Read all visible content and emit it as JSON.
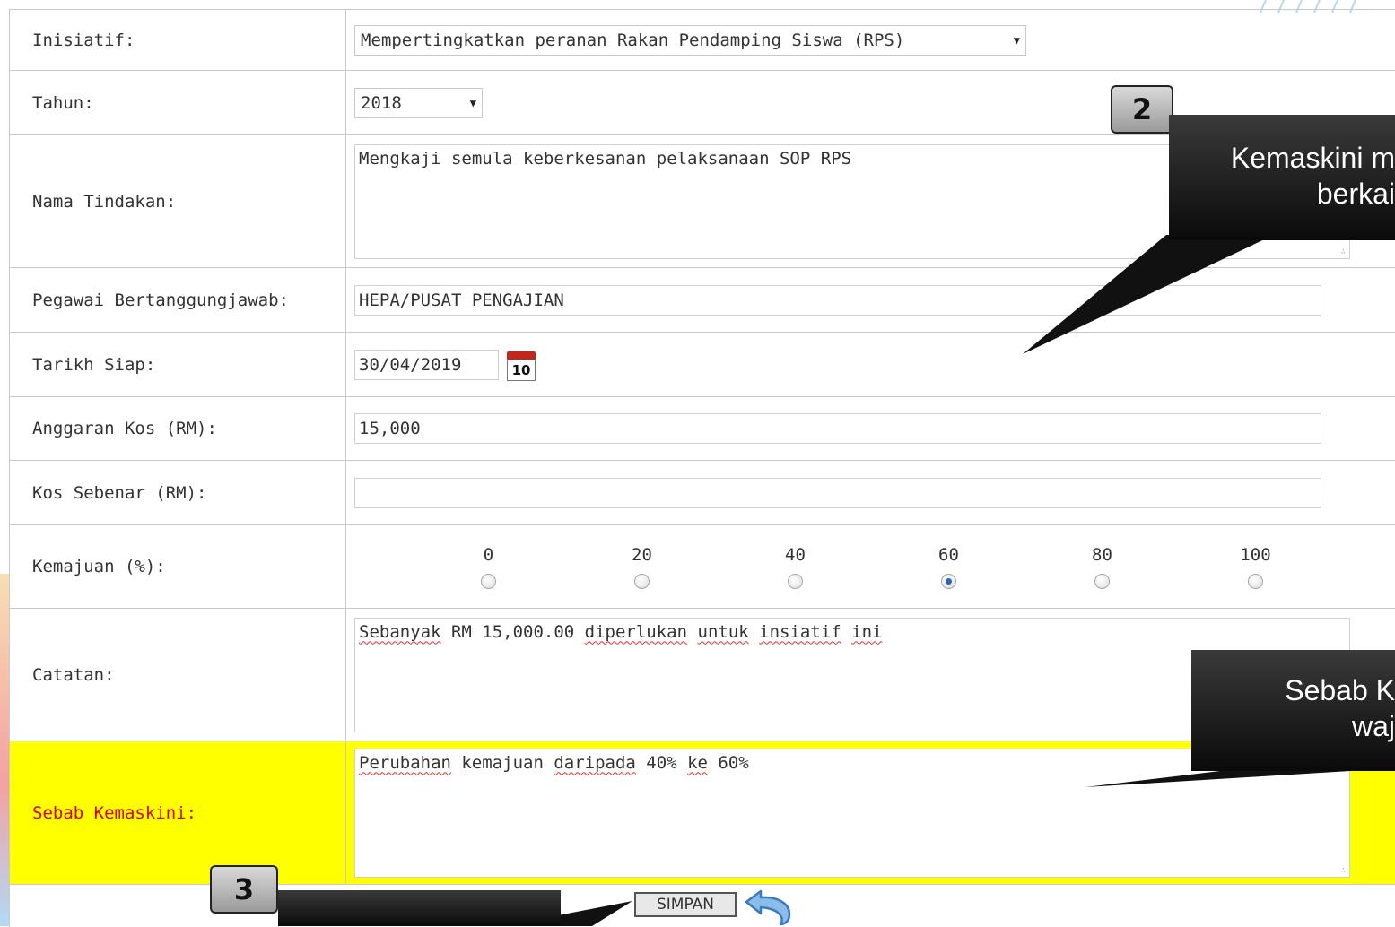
{
  "form": {
    "inisiatif": {
      "label": "Inisiatif:",
      "value": "Mempertingkatkan peranan Rakan Pendamping Siswa (RPS)"
    },
    "tahun": {
      "label": "Tahun:",
      "value": "2018"
    },
    "nama_tindakan": {
      "label": "Nama Tindakan:",
      "value": "Mengkaji semula keberkesanan pelaksanaan SOP RPS"
    },
    "pegawai": {
      "label": "Pegawai Bertanggungjawab:",
      "value": "HEPA/PUSAT PENGAJIAN"
    },
    "tarikh_siap": {
      "label": "Tarikh Siap:",
      "value": "30/04/2019",
      "calendar_day": "10"
    },
    "anggaran_kos": {
      "label": "Anggaran Kos (RM):",
      "value": "15,000"
    },
    "kos_sebenar": {
      "label": "Kos Sebenar (RM):",
      "value": ""
    },
    "kemajuan": {
      "label": "Kemajuan (%):",
      "options": [
        "0",
        "20",
        "40",
        "60",
        "80",
        "100"
      ],
      "selected": "60"
    },
    "catatan": {
      "label": "Catatan:",
      "parts": [
        "Sebanyak",
        " RM 15,000.00 ",
        "diperlukan",
        " ",
        "untuk",
        " ",
        "insiatif",
        " ",
        "ini"
      ]
    },
    "sebab_kemaskini": {
      "label": "Sebab Kemaskini:",
      "parts": [
        "Perubahan",
        " kemajuan ",
        "daripada",
        " 40% ",
        "ke",
        " 60%"
      ]
    }
  },
  "actions": {
    "save_label": "SIMPAN",
    "back_icon": "back-arrow-icon"
  },
  "annotations": {
    "badge2": "2",
    "badge3": "3",
    "callout2_line1": "Kemaskini m",
    "callout2_line2": "berkai",
    "callout_sebab_line1": "Sebab K",
    "callout_sebab_line2": "waj"
  },
  "colors": {
    "highlight_row": "#ffff00",
    "highlight_label": "#d80000",
    "radio_selected": "#2f63b8"
  }
}
